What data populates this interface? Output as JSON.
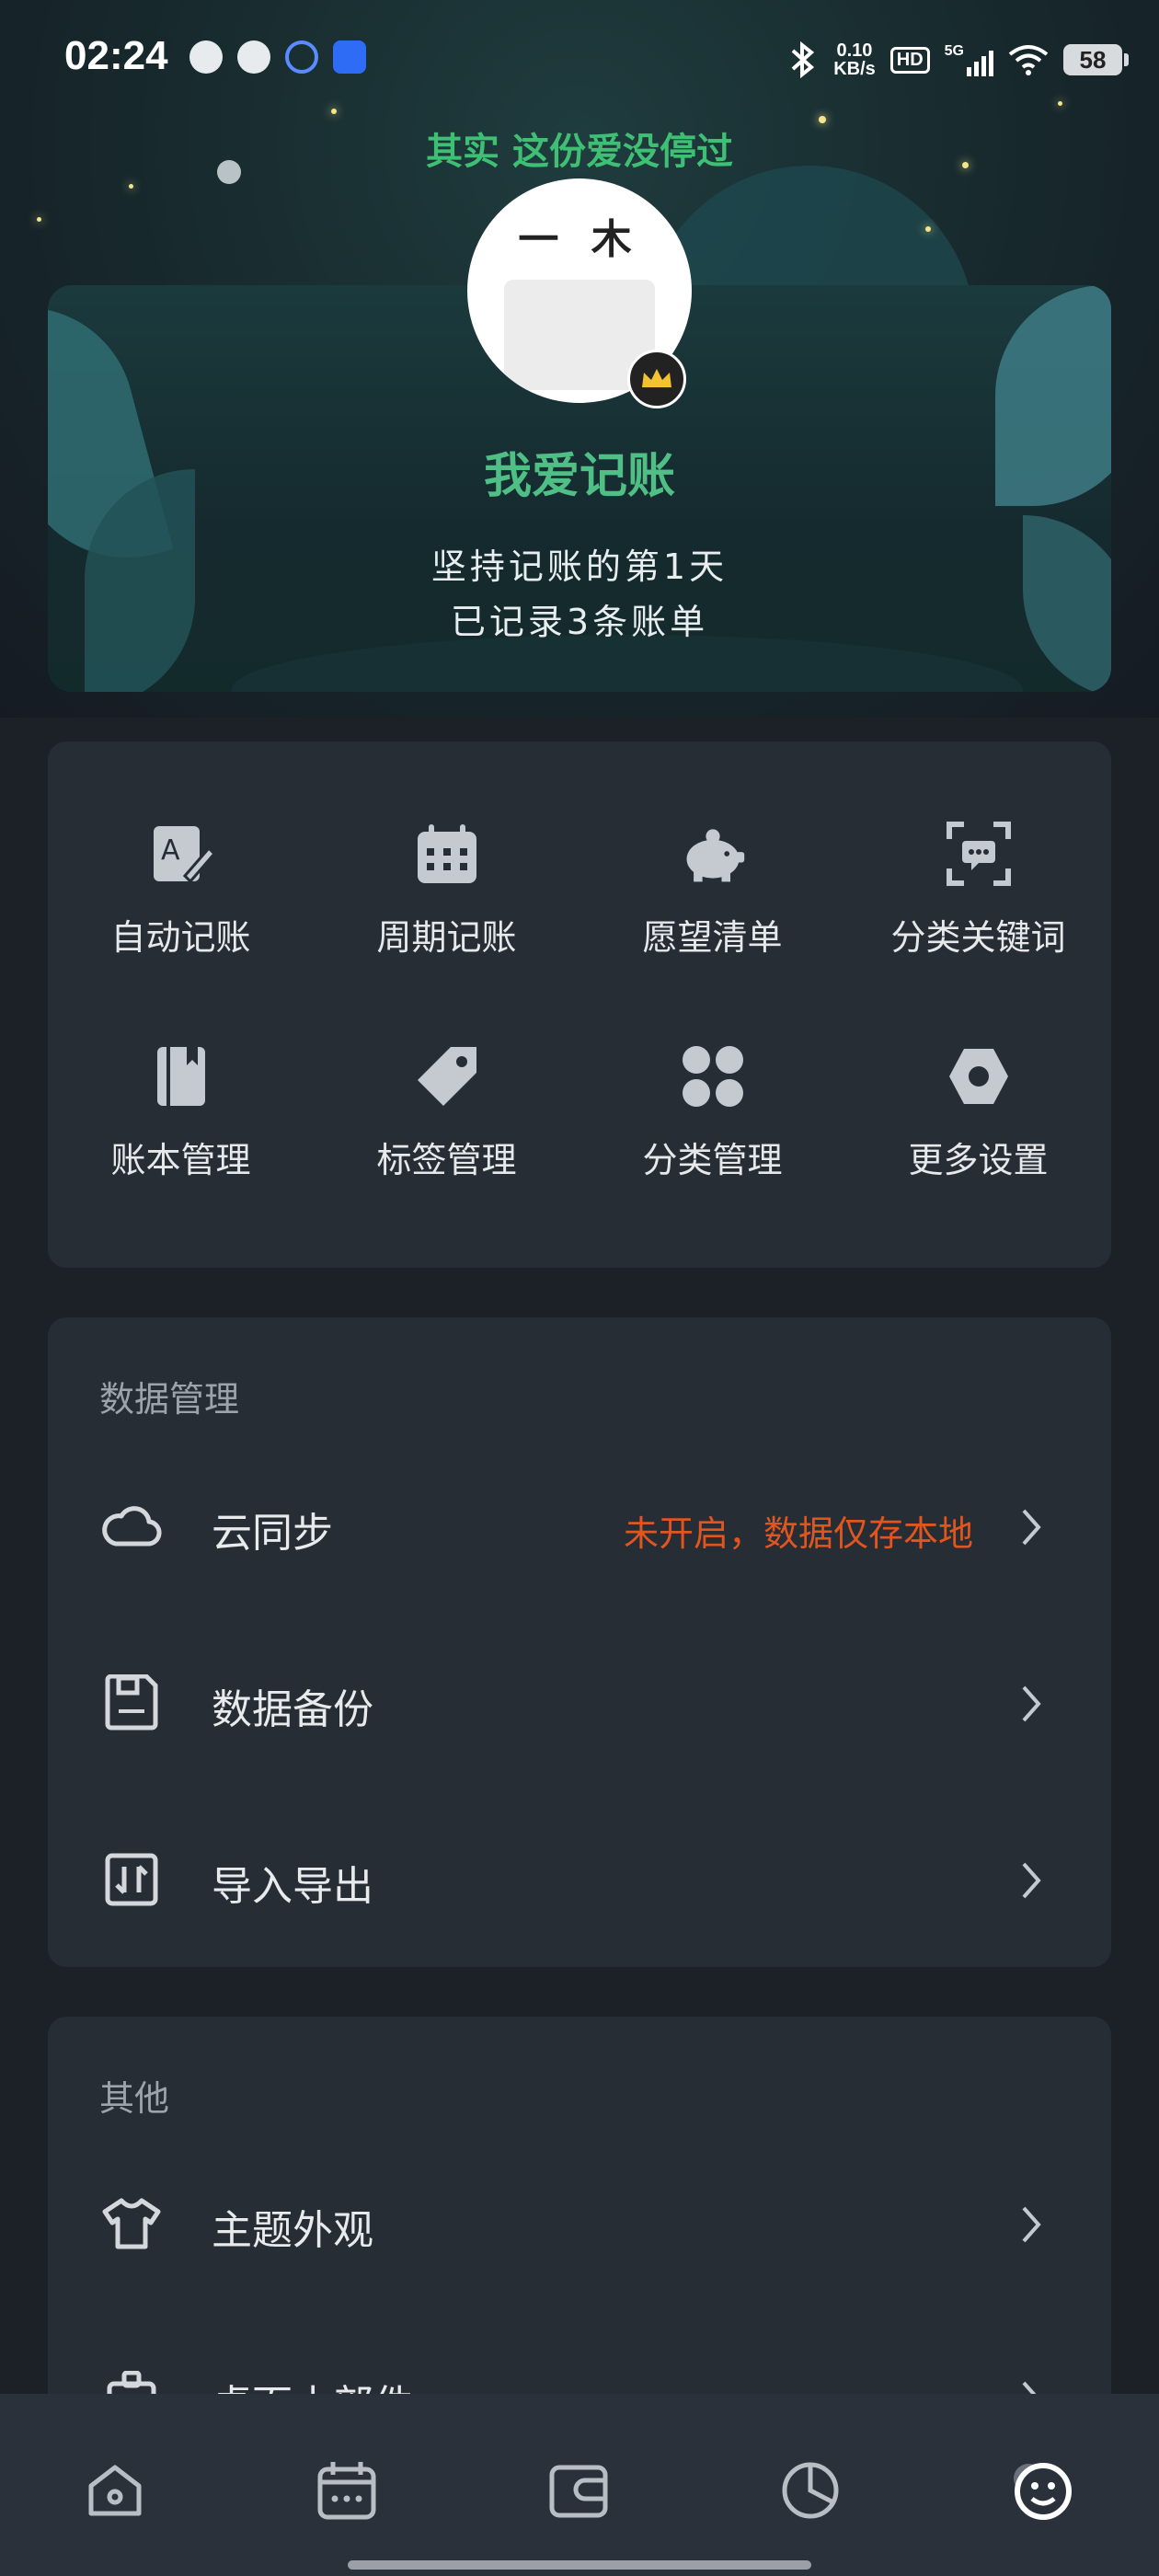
{
  "status_bar": {
    "time": "02:24",
    "net_speed_value": "0.10",
    "net_speed_unit": "KB/s",
    "hd_label": "HD",
    "network_label": "5G",
    "battery": "58"
  },
  "profile": {
    "slogan": "其实 这份爱没停过",
    "avatar_text": "一 木",
    "username": "我爱记账",
    "days_text": "坚持记账的第1天",
    "records_text": "已记录3条账单"
  },
  "shortcuts": [
    {
      "label": "自动记账",
      "icon": "auto-bookkeeping-icon"
    },
    {
      "label": "周期记账",
      "icon": "calendar-icon"
    },
    {
      "label": "愿望清单",
      "icon": "piggy-bank-icon"
    },
    {
      "label": "分类关键词",
      "icon": "keyword-scan-icon"
    },
    {
      "label": "账本管理",
      "icon": "ledger-book-icon"
    },
    {
      "label": "标签管理",
      "icon": "tag-icon"
    },
    {
      "label": "分类管理",
      "icon": "category-grid-icon"
    },
    {
      "label": "更多设置",
      "icon": "hexagon-settings-icon"
    }
  ],
  "data_section": {
    "title": "数据管理",
    "items": [
      {
        "label": "云同步",
        "value": "未开启，数据仅存本地",
        "icon": "cloud-icon"
      },
      {
        "label": "数据备份",
        "value": "",
        "icon": "save-icon"
      },
      {
        "label": "导入导出",
        "value": "",
        "icon": "import-export-icon"
      }
    ]
  },
  "other_section": {
    "title": "其他",
    "items": [
      {
        "label": "主题外观",
        "icon": "shirt-icon"
      },
      {
        "label": "桌面小部件",
        "icon": "widget-icon"
      }
    ]
  },
  "bottom_nav": [
    {
      "name": "home",
      "icon": "home-icon"
    },
    {
      "name": "calendar",
      "icon": "calendar-nav-icon"
    },
    {
      "name": "wallet",
      "icon": "wallet-icon"
    },
    {
      "name": "stats",
      "icon": "pie-chart-icon"
    },
    {
      "name": "mine",
      "icon": "profile-face-icon"
    }
  ],
  "colors": {
    "accent_green": "#4fbf86",
    "warning_orange": "#e0561e",
    "card_bg": "#272d35",
    "page_bg": "#1c2128"
  }
}
